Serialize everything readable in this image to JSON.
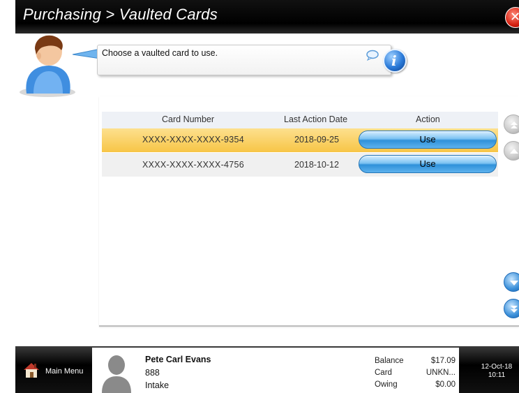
{
  "header": {
    "title": "Purchasing > Vaulted Cards",
    "close_icon": "close-icon"
  },
  "assistant": {
    "message": "Choose a vaulted card to use.",
    "avatar_icon": "assistant-avatar-icon",
    "chat_icon": "speech-bubble-icon",
    "info_icon": "info-icon",
    "info_glyph": "i"
  },
  "table": {
    "columns": [
      "Card Number",
      "Last Action Date",
      "Action"
    ],
    "rows": [
      {
        "card_number": "XXXX-XXXX-XXXX-9354",
        "last_action_date": "2018-09-25",
        "action": "Use",
        "selected": true
      },
      {
        "card_number": "XXXX-XXXX-XXXX-4756",
        "last_action_date": "2018-10-12",
        "action": "Use",
        "selected": false
      }
    ],
    "colors": {
      "selected_row": "#f9c94a",
      "alt_row": "#f0f0f0",
      "header": "#eef1f6",
      "button": "#3a9be0"
    }
  },
  "scroll": {
    "top_icon": "scroll-to-top-icon",
    "up_icon": "scroll-up-icon",
    "down_icon": "scroll-down-icon",
    "bottom_icon": "scroll-to-bottom-icon"
  },
  "footer": {
    "main_menu_label": "Main Menu",
    "main_menu_icon": "house-icon",
    "customer": {
      "name": "Pete Carl Evans",
      "id": "888",
      "status": "Intake",
      "photo_icon": "person-silhouette-icon",
      "balance_label": "Balance",
      "balance_value": "$17.09",
      "card_label": "Card",
      "card_value": "UNKN...",
      "owing_label": "Owing",
      "owing_value": "$0.00"
    },
    "date": "12-Oct-18",
    "time": "10:11"
  }
}
